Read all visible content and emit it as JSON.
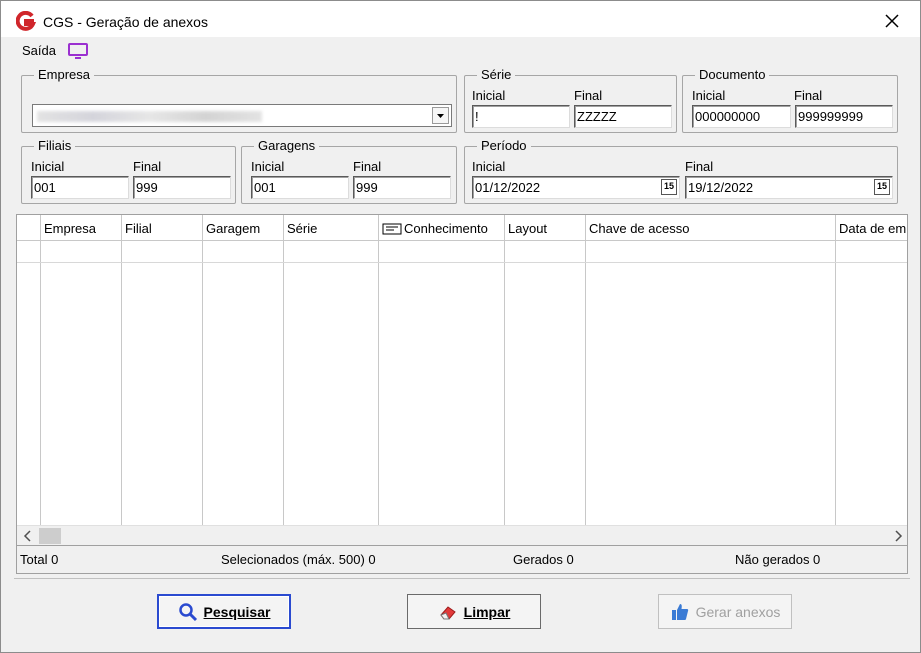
{
  "window": {
    "title": "CGS - Geração de anexos",
    "close_icon": "close-icon",
    "app_icon": "cgs-logo-icon"
  },
  "menu": {
    "exit_label": "Saída",
    "exit_icon": "monitor-icon"
  },
  "empresa": {
    "group_label": "Empresa",
    "selected_value": ""
  },
  "serie": {
    "group_label": "Série",
    "initial_label": "Inicial",
    "initial_value": "!",
    "final_label": "Final",
    "final_value": "ZZZZZ"
  },
  "documento": {
    "group_label": "Documento",
    "initial_label": "Inicial",
    "initial_value": "000000000",
    "final_label": "Final",
    "final_value": "999999999"
  },
  "filiais": {
    "group_label": "Filiais",
    "initial_label": "Inicial",
    "initial_value": "001",
    "final_label": "Final",
    "final_value": "999"
  },
  "garagens": {
    "group_label": "Garagens",
    "initial_label": "Inicial",
    "initial_value": "001",
    "final_label": "Final",
    "final_value": "999"
  },
  "periodo": {
    "group_label": "Período",
    "initial_label": "Inicial",
    "initial_value": "01/12/2022",
    "final_label": "Final",
    "final_value": "19/12/2022",
    "calendar_glyph": "15"
  },
  "grid": {
    "columns": [
      "Empresa",
      "Filial",
      "Garagem",
      "Série",
      "Conhecimento",
      "Layout",
      "Chave de acesso",
      "Data de em"
    ]
  },
  "status": {
    "total": "Total 0",
    "selected": "Selecionados (máx. 500) 0",
    "generated": "Gerados 0",
    "not_generated": "Não gerados 0"
  },
  "buttons": {
    "search": "Pesquisar",
    "clear": "Limpar",
    "generate": "Gerar anexos"
  },
  "colors": {
    "accent": "#2a4ad0",
    "logo_red": "#d0262b",
    "menu_icon": "#9b30d0"
  }
}
